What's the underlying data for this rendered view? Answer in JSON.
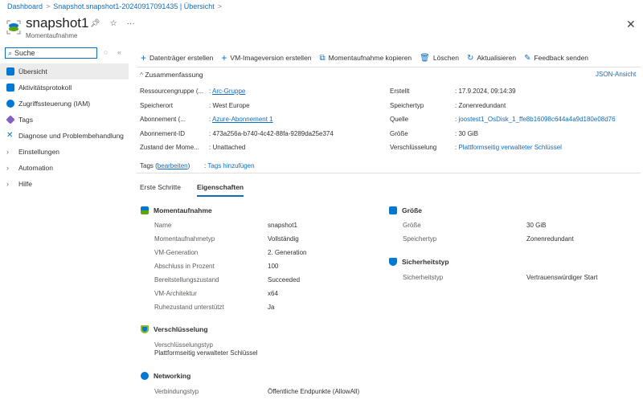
{
  "breadcrumb": [
    "Dashboard",
    "Snapshot.snapshot1-20240917091435 | Übersicht"
  ],
  "header": {
    "title": "snapshot1",
    "subtitle": "Momentaufnahme"
  },
  "search": {
    "value": "Suche"
  },
  "sidebar": {
    "items": [
      {
        "label": "Übersicht",
        "icon": "snapshot-icon",
        "color": "#0078d4"
      },
      {
        "label": "Aktivitätsprotokoll",
        "icon": "activity-log-icon",
        "color": "#0078d4"
      },
      {
        "label": "Zugriffssteuerung (IAM)",
        "icon": "iam-icon",
        "color": "#0078d4"
      },
      {
        "label": "Tags",
        "icon": "tag-icon",
        "color": "#8661c5"
      },
      {
        "label": "Diagnose und Problembehandlung",
        "icon": "diagnose-icon",
        "color": "#0078d4"
      },
      {
        "label": "Einstellungen",
        "icon": "chevron-right-icon"
      },
      {
        "label": "Automation",
        "icon": "chevron-right-icon"
      },
      {
        "label": "Hilfe",
        "icon": "chevron-right-icon"
      }
    ]
  },
  "toolbar": [
    "Datenträger erstellen",
    "VM-Imageversion erstellen",
    "Momentaufnahme kopieren",
    "Löschen",
    "Aktualisieren",
    "Feedback senden"
  ],
  "summary": {
    "title": "Zusammenfassung",
    "json_view": "JSON-Ansicht",
    "left": [
      {
        "k": "Ressourcengruppe (...",
        "v": "Arc-Gruppe",
        "link": true
      },
      {
        "k": "Speicherort",
        "v": "West Europe"
      },
      {
        "k": "Abonnement (...",
        "v": "Azure-Abonnement 1",
        "link": true
      },
      {
        "k": "Abonnement-ID",
        "v": "473a256a-b740-4c42-88fa-9289da25e374"
      },
      {
        "k": "Zustand der Mome...",
        "v": "Unattached"
      }
    ],
    "right": [
      {
        "k": "Erstellt",
        "v": "17.9.2024, 09:14:39"
      },
      {
        "k": "Speichertyp",
        "v": "Zonenredundant"
      },
      {
        "k": "Quelle",
        "v": "joostest1_OsDisk_1_ffe8b16098c644a4a9d180e08d76",
        "link": true
      },
      {
        "k": "Größe",
        "v": "30 GiB"
      },
      {
        "k": "Verschlüsselung",
        "v": "Plattformseitig verwalteter Schlüssel",
        "link": true
      }
    ],
    "tags_label": "Tags",
    "tags_edit": "bearbeiten",
    "tags_add": "Tags hinzufügen"
  },
  "tabs": [
    "Erste Schritte",
    "Eigenschaften"
  ],
  "props": {
    "snapshot": {
      "title": "Momentaufnahme",
      "rows": [
        [
          "Name",
          "snapshot1"
        ],
        [
          "Momentaufnahmetyp",
          "Vollständig"
        ],
        [
          "VM-Generation",
          "2. Generation"
        ],
        [
          "Abschluss in Prozent",
          "100"
        ],
        [
          "Bereitstellungszustand",
          "Succeeded"
        ],
        [
          "VM-Architektur",
          "x64"
        ],
        [
          "Ruhezustand unterstützt",
          "Ja"
        ]
      ]
    },
    "encryption": {
      "title": "Verschlüsselung",
      "type_label": "Verschlüsselungstyp",
      "type_value": "Plattformseitig verwalteter Schlüssel"
    },
    "networking": {
      "title": "Networking",
      "rows": [
        [
          "Verbindungstyp",
          "Öffentliche Endpunkte (AllowAll)"
        ]
      ]
    },
    "size": {
      "title": "Größe",
      "rows": [
        [
          "Größe",
          "30 GiB"
        ],
        [
          "Speichertyp",
          "Zonenredundant"
        ]
      ]
    },
    "security": {
      "title": "Sicherheitstyp",
      "rows": [
        [
          "Sicherheitstyp",
          "Vertrauenswürdiger Start"
        ]
      ]
    }
  }
}
